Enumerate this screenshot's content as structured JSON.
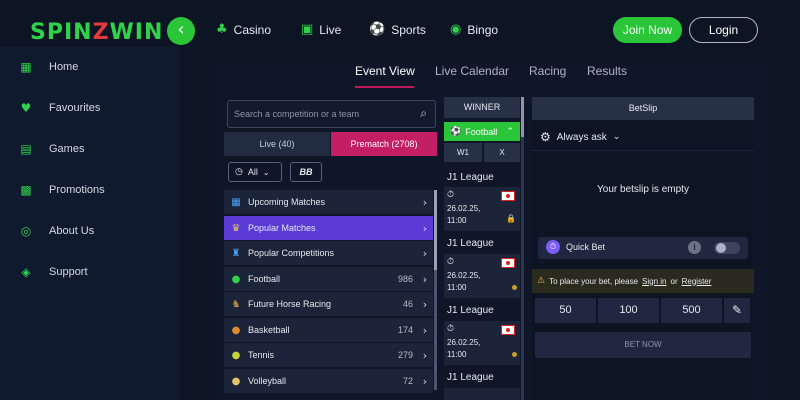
{
  "brand": {
    "logo_a": "SPIN",
    "logo_b": "Z",
    "logo_c": "WIN"
  },
  "header": {
    "nav": [
      {
        "label": "Casino",
        "icon": "clubs-icon"
      },
      {
        "label": "Live",
        "icon": "live-icon"
      },
      {
        "label": "Sports",
        "icon": "sports-icon"
      },
      {
        "label": "Bingo",
        "icon": "bingo-icon"
      }
    ],
    "join_label": "Join Now",
    "login_label": "Login"
  },
  "sidebar": {
    "items": [
      {
        "label": "Home",
        "icon": "grid-icon"
      },
      {
        "label": "Favourites",
        "icon": "heart-icon"
      },
      {
        "label": "Games",
        "icon": "games-icon"
      },
      {
        "label": "Promotions",
        "icon": "gift-icon"
      },
      {
        "label": "About Us",
        "icon": "target-icon"
      },
      {
        "label": "Support",
        "icon": "support-icon"
      }
    ]
  },
  "tabs": [
    "Event View",
    "Live Calendar",
    "Racing",
    "Results"
  ],
  "sports_panel": {
    "search_placeholder": "Search a competition or a team",
    "live_label": "Live (40)",
    "prematch_label": "Prematch (2708)",
    "all_label": "All",
    "bb_label": "BB",
    "rows": [
      {
        "label": "Upcoming Matches",
        "count": ""
      },
      {
        "label": "Popular Matches",
        "count": ""
      },
      {
        "label": "Popular Competitions",
        "count": ""
      },
      {
        "label": "Football",
        "count": "986"
      },
      {
        "label": "Future Horse Racing",
        "count": "46"
      },
      {
        "label": "Basketball",
        "count": "174"
      },
      {
        "label": "Tennis",
        "count": "279"
      },
      {
        "label": "Volleyball",
        "count": "72"
      }
    ]
  },
  "odds_panel": {
    "winner_label": "WINNER",
    "football_label": "Football",
    "w1_label": "W1",
    "x_label": "X",
    "events": [
      {
        "league": "J1 League",
        "date": "26.02.25,",
        "time": "11:00"
      },
      {
        "league": "J1 League",
        "date": "26.02.25,",
        "time": "11:00"
      },
      {
        "league": "J1 League",
        "date": "26.02.25,",
        "time": "11:00"
      },
      {
        "league": "J1 League",
        "date": "",
        "time": ""
      }
    ]
  },
  "betslip": {
    "title": "BetSlip",
    "always_ask": "Always ask",
    "empty_text": "Your betslip is empty",
    "quick_bet": "Quick Bet",
    "notice_pre": "To place your bet, please",
    "sign_in": "Sign in",
    "or": "or",
    "register": "Register",
    "amounts": [
      "50",
      "100",
      "500"
    ],
    "bet_now": "BET NOW"
  },
  "colors": {
    "accent_green": "#2bc53a",
    "prematch_pink": "#c21f64",
    "active_purple": "#5b3bd6"
  }
}
